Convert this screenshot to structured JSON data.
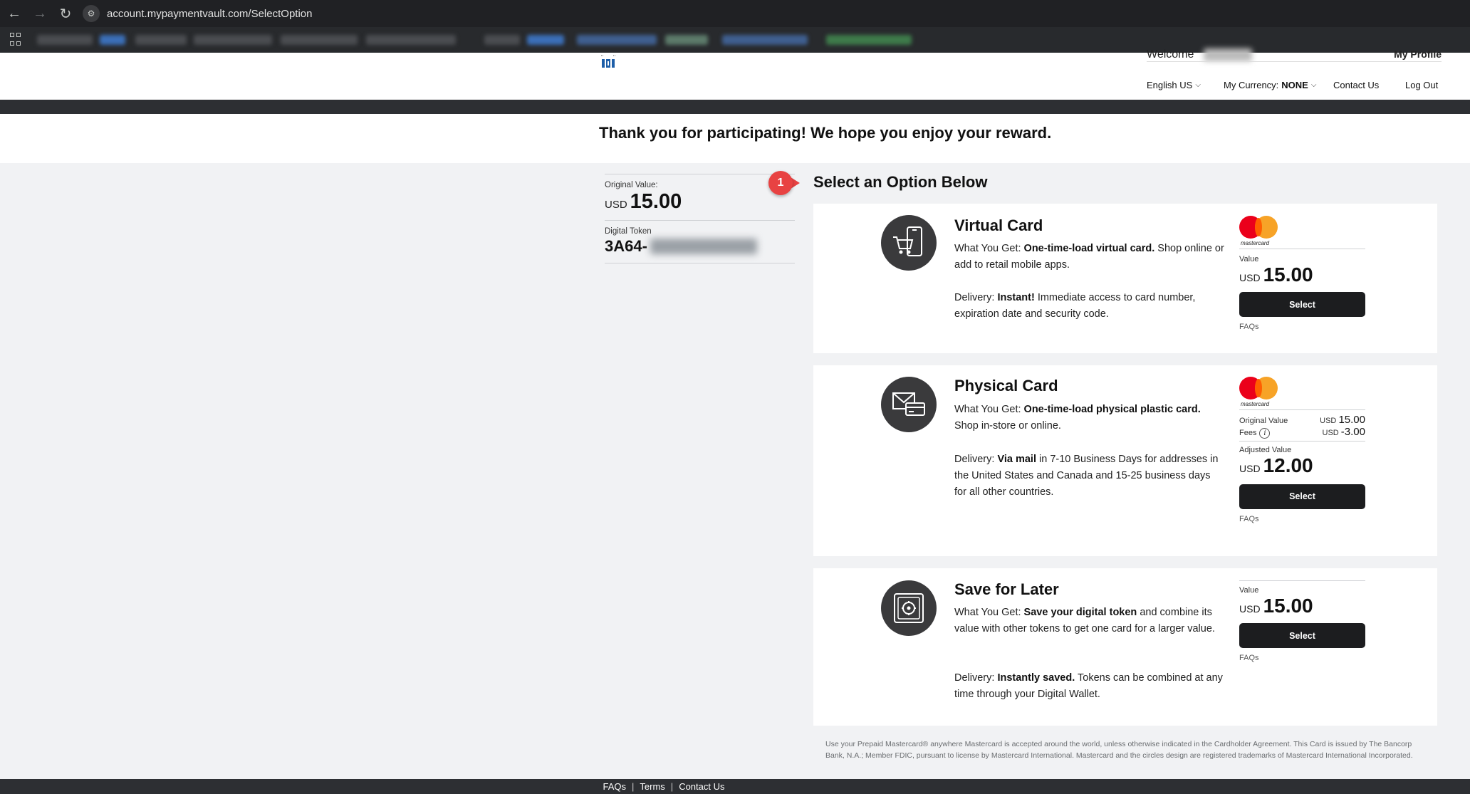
{
  "browser": {
    "url": "account.mypaymentvault.com/SelectOption"
  },
  "header": {
    "welcome": "Welcome",
    "my_profile": "My Profile",
    "language": "English US",
    "currency_label": "My Currency:",
    "currency_value": "NONE",
    "contact_us": "Contact Us",
    "log_out": "Log Out"
  },
  "thanks_message": "Thank you for participating! We hope you enjoy your reward.",
  "summary": {
    "original_value_label": "Original Value:",
    "currency": "USD",
    "original_value": "15.00",
    "digital_token_label": "Digital Token",
    "digital_token_prefix": "3A64-"
  },
  "step_number": "1",
  "select_heading": "Select an Option Below",
  "options": [
    {
      "title": "Virtual Card",
      "what_prefix": "What You Get: ",
      "what_bold": "One-time-load virtual card.",
      "what_rest": " Shop online or add to retail mobile apps.",
      "delivery_prefix": "Delivery: ",
      "delivery_bold": "Instant!",
      "delivery_rest": " Immediate access to card number, expiration date and security code.",
      "brand_text": "mastercard",
      "value_label": "Value",
      "currency": "USD",
      "value": "15.00",
      "select_label": "Select",
      "faqs_label": "FAQs"
    },
    {
      "title": "Physical Card",
      "what_prefix": "What You Get: ",
      "what_bold": "One-time-load physical plastic card.",
      "what_rest": " Shop in-store or online.",
      "delivery_prefix": "Delivery: ",
      "delivery_bold": "Via mail",
      "delivery_rest": " in 7-10 Business Days for addresses in the United States and Canada and 15-25 business days for all other countries.",
      "brand_text": "mastercard",
      "original_value_label": "Original Value",
      "original_value": "15.00",
      "fees_label": "Fees",
      "fees_value": "-3.00",
      "adjusted_value_label": "Adjusted Value",
      "currency": "USD",
      "value": "12.00",
      "select_label": "Select",
      "faqs_label": "FAQs"
    },
    {
      "title": "Save for Later",
      "what_prefix": "What You Get: ",
      "what_bold": "Save your digital token",
      "what_rest": " and combine its value with other tokens to get one card for a larger value.",
      "delivery_prefix": "Delivery: ",
      "delivery_bold": "Instantly saved.",
      "delivery_rest": " Tokens can be combined at any time through your Digital Wallet.",
      "value_label": "Value",
      "currency": "USD",
      "value": "15.00",
      "select_label": "Select",
      "faqs_label": "FAQs"
    }
  ],
  "disclaimer": "Use your Prepaid Mastercard® anywhere Mastercard is accepted around the world, unless otherwise indicated in the Cardholder Agreement. This Card is issued by The Bancorp Bank, N.A.; Member FDIC, pursuant to license by Mastercard International. Mastercard and the circles design are registered trademarks of Mastercard International Incorporated.",
  "footer": {
    "faqs": "FAQs",
    "terms": "Terms",
    "contact_us": "Contact Us",
    "separator": "|"
  },
  "colors": {
    "page_bg": "#f1f2f4",
    "dark_band": "#2d2f33",
    "button_bg": "#1c1d1f",
    "step_marker": "#e84242",
    "mastercard_red": "#eb001b",
    "mastercard_yellow": "#f79e1b"
  },
  "icons": {
    "virtual": "phone-cart-icon",
    "physical": "envelope-card-icon",
    "save": "safe-icon"
  }
}
